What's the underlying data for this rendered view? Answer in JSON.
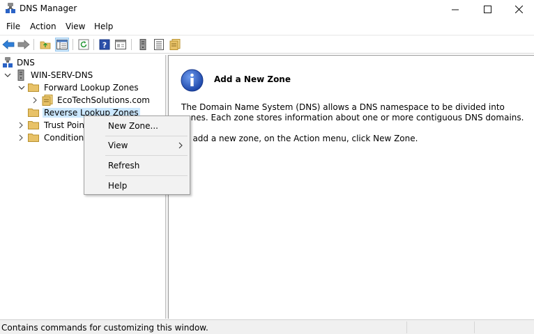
{
  "window": {
    "title": "DNS Manager",
    "controls": {
      "minimize": "—",
      "maximize": "☐",
      "close": "✕"
    }
  },
  "menubar": {
    "items": [
      "File",
      "Action",
      "View",
      "Help"
    ]
  },
  "toolbar": {
    "buttons": [
      "back-arrow-icon",
      "forward-arrow-icon",
      "up-folder-icon",
      "show-hide-console-tree-icon",
      "refresh-icon",
      "help-icon",
      "properties-icon",
      "server-icon",
      "list-icon",
      "zone-icon"
    ]
  },
  "tree": {
    "root": "DNS",
    "server": "WIN-SERV-DNS",
    "forward": "Forward Lookup Zones",
    "zone": "EcoTechSolutions.com",
    "reverse": "Reverse Lookup Zones",
    "trust": "Trust Point",
    "conditional": "Conditiona"
  },
  "detail": {
    "heading": "Add a New Zone",
    "p1": "The Domain Name System (DNS) allows a DNS namespace to be divided into zones. Each zone stores information about one or more contiguous DNS domains.",
    "p2": "To add a new zone, on the Action menu, click New Zone."
  },
  "context_menu": {
    "new_zone": "New Zone...",
    "view": "View",
    "refresh": "Refresh",
    "help": "Help",
    "submenu_arrow": "›"
  },
  "status": {
    "text": "Contains commands for customizing this window."
  },
  "colors": {
    "selection": "#cce8ff",
    "menu_bg": "#f2f2f2",
    "folder": "#e8c268",
    "accent_blue": "#2b63c6"
  }
}
